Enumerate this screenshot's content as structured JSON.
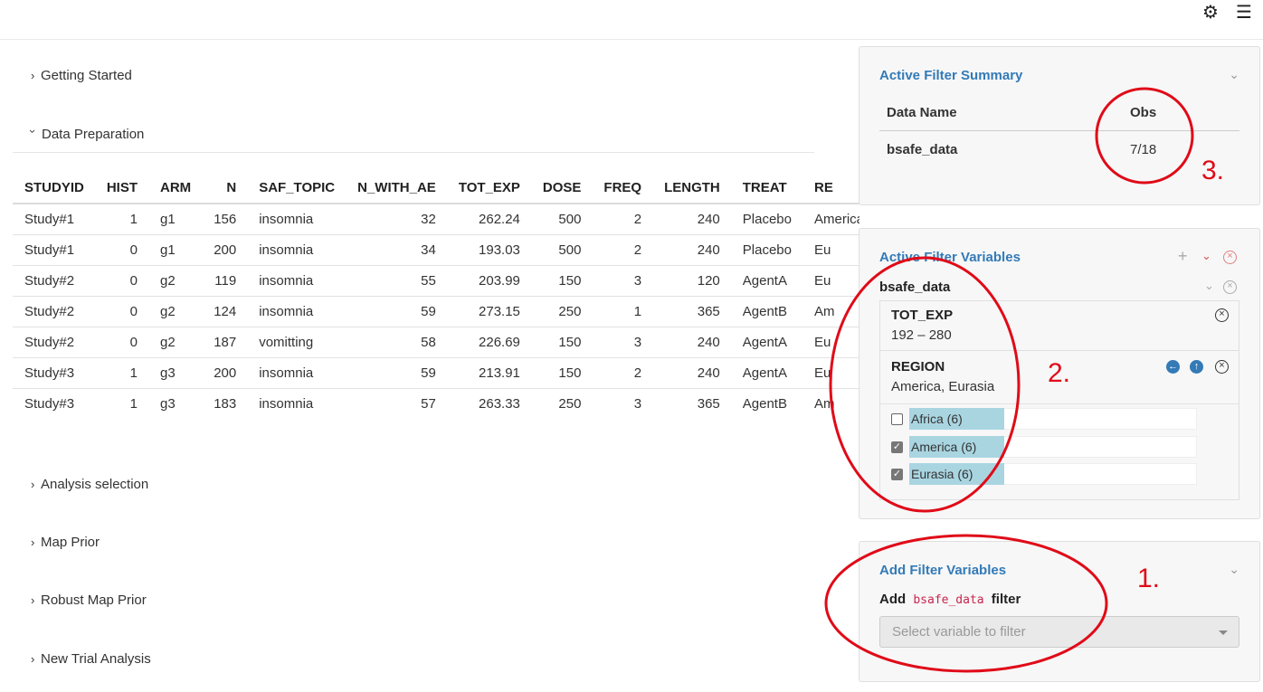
{
  "topbar": {
    "settings_icon": "gear-icon",
    "menu_icon": "hamburger-menu-icon"
  },
  "accordions": {
    "getting_started": "Getting Started",
    "data_preparation": "Data Preparation",
    "analysis_selection": "Analysis selection",
    "map_prior": "Map Prior",
    "robust_map_prior": "Robust Map Prior",
    "new_trial_analysis": "New Trial Analysis"
  },
  "table": {
    "columns": [
      "STUDYID",
      "HIST",
      "ARM",
      "N",
      "SAF_TOPIC",
      "N_WITH_AE",
      "TOT_EXP",
      "DOSE",
      "FREQ",
      "LENGTH",
      "TREAT",
      "RE"
    ],
    "rows": [
      [
        "Study#1",
        "1",
        "g1",
        "156",
        "insomnia",
        "32",
        "262.24",
        "500",
        "2",
        "240",
        "Placebo",
        "America"
      ],
      [
        "Study#1",
        "0",
        "g1",
        "200",
        "insomnia",
        "34",
        "193.03",
        "500",
        "2",
        "240",
        "Placebo",
        "Eu"
      ],
      [
        "Study#2",
        "0",
        "g2",
        "119",
        "insomnia",
        "55",
        "203.99",
        "150",
        "3",
        "120",
        "AgentA",
        "Eu"
      ],
      [
        "Study#2",
        "0",
        "g2",
        "124",
        "insomnia",
        "59",
        "273.15",
        "250",
        "1",
        "365",
        "AgentB",
        "Am"
      ],
      [
        "Study#2",
        "0",
        "g2",
        "187",
        "vomitting",
        "58",
        "226.69",
        "150",
        "3",
        "240",
        "AgentA",
        "Eu"
      ],
      [
        "Study#3",
        "1",
        "g3",
        "200",
        "insomnia",
        "59",
        "213.91",
        "150",
        "2",
        "240",
        "AgentA",
        "Eu"
      ],
      [
        "Study#3",
        "1",
        "g3",
        "183",
        "insomnia",
        "57",
        "263.33",
        "250",
        "3",
        "365",
        "AgentB",
        "Am"
      ]
    ]
  },
  "summary": {
    "title": "Active Filter Summary",
    "col_name": "Data Name",
    "col_obs": "Obs",
    "row_name": "bsafe_data",
    "row_obs": "7/18"
  },
  "active_filters": {
    "title": "Active Filter Variables",
    "dataset": "bsafe_data",
    "tot_exp": {
      "name": "TOT_EXP",
      "range": "192 – 280"
    },
    "region": {
      "name": "REGION",
      "selected": "America, Eurasia",
      "options": [
        {
          "label": "Africa (6)",
          "checked": false,
          "fraction": 0.33
        },
        {
          "label": "America (6)",
          "checked": true,
          "fraction": 0.33
        },
        {
          "label": "Eurasia (6)",
          "checked": true,
          "fraction": 0.33
        }
      ]
    }
  },
  "add_filter": {
    "title": "Add Filter Variables",
    "label_prefix": "Add",
    "dataset_code": "bsafe_data",
    "label_suffix": "filter",
    "placeholder": "Select variable to filter"
  },
  "annotations": {
    "one": "1.",
    "two": "2.",
    "three": "3.",
    "color": "#e00b18"
  }
}
